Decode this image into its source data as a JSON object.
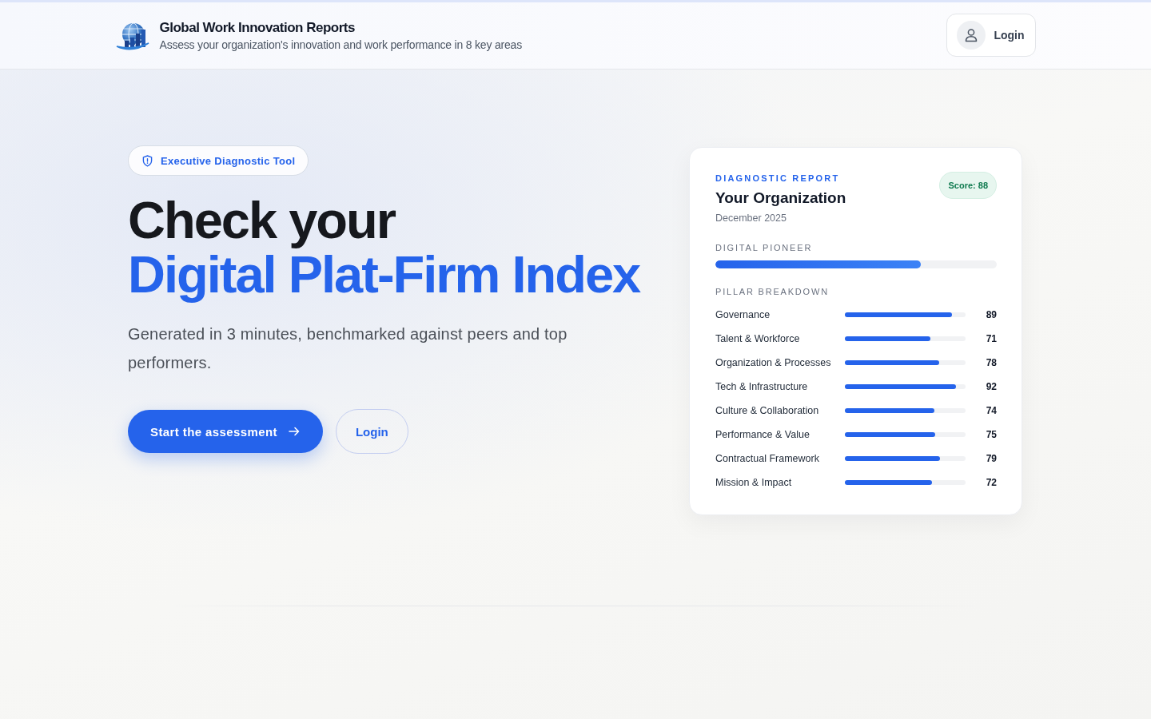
{
  "header": {
    "title": "Global Work Innovation Reports",
    "subtitle": "Assess your organization's innovation and work performance in 8 key areas",
    "login_button": "Login"
  },
  "hero": {
    "badge": "Executive Diagnostic Tool",
    "heading_line_1": "Check your",
    "heading_line_2": "Digital Plat-Firm Index",
    "description": "Generated in 3 minutes, benchmarked against peers and top performers.",
    "primary_button": "Start the assessment",
    "secondary_button": "Login"
  },
  "report_card": {
    "eyebrow": "DIAGNOSTIC REPORT",
    "title": "Your Organization",
    "date": "December 2025",
    "score": "Score: 88",
    "profile": {
      "label": "DIGITAL PIONEER",
      "level": 0.73
    },
    "breakdown_title": "PILLAR BREAKDOWN",
    "pillars": [
      {
        "name": "Governance",
        "level": 0.89,
        "value": "89"
      },
      {
        "name": "Talent & Workforce",
        "level": 0.71,
        "value": "71"
      },
      {
        "name": "Organization & Processes",
        "level": 0.78,
        "value": "78"
      },
      {
        "name": "Tech & Infrastructure",
        "level": 0.92,
        "value": "92"
      },
      {
        "name": "Culture & Collaboration",
        "level": 0.74,
        "value": "74"
      },
      {
        "name": "Performance & Value",
        "level": 0.75,
        "value": "75"
      },
      {
        "name": "Contractual Framework",
        "level": 0.79,
        "value": "79"
      },
      {
        "name": "Mission & Impact",
        "level": 0.72,
        "value": "72"
      }
    ]
  }
}
